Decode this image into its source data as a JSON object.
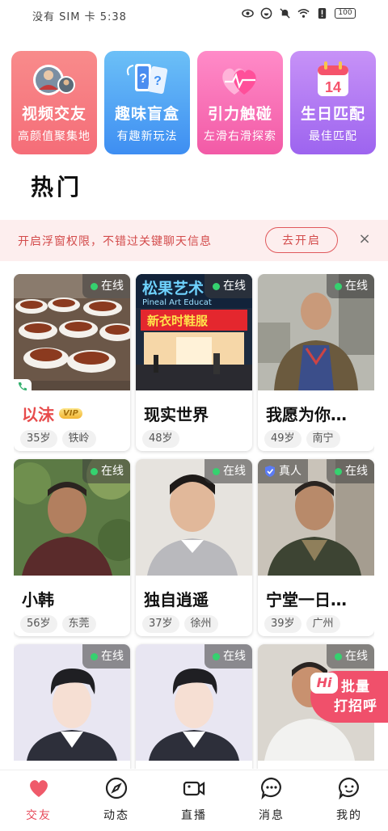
{
  "status_bar": {
    "carrier": "没有 SIM 卡 5:38",
    "battery": "100"
  },
  "features": [
    {
      "title": "视频交友",
      "subtitle": "高颜值聚集地",
      "icon": "video-avatars-icon"
    },
    {
      "title": "趣味盲盒",
      "subtitle": "有趣新玩法",
      "icon": "mystery-box-icon"
    },
    {
      "title": "引力触碰",
      "subtitle": "左滑右滑探索",
      "icon": "heart-pulse-icon"
    },
    {
      "title": "生日匹配",
      "subtitle": "最佳匹配",
      "icon": "calendar-14-icon"
    }
  ],
  "calendar_day": "14",
  "section_title": "热门",
  "notice": {
    "text": "开启浮窗权限，不错过关键聊天信息",
    "button": "去开启",
    "close": "×"
  },
  "online_label": "在线",
  "verified_label": "真人",
  "vip_label": "VIP",
  "profiles": [
    {
      "name": "以沫",
      "age": "35岁",
      "city": "铁岭",
      "vip": true,
      "verified": false
    },
    {
      "name": "现实世界",
      "age": "48岁",
      "city": "",
      "vip": false,
      "verified": false
    },
    {
      "name": "我愿为你…",
      "age": "49岁",
      "city": "南宁",
      "vip": false,
      "verified": false
    },
    {
      "name": "小韩",
      "age": "56岁",
      "city": "东莞",
      "vip": false,
      "verified": false
    },
    {
      "name": "独自逍遥",
      "age": "37岁",
      "city": "徐州",
      "vip": false,
      "verified": false
    },
    {
      "name": "宁堂一日…",
      "age": "39岁",
      "city": "广州",
      "vip": false,
      "verified": true
    },
    {
      "name": "",
      "age": "",
      "city": "",
      "vip": false,
      "verified": false
    },
    {
      "name": "",
      "age": "",
      "city": "",
      "vip": false,
      "verified": false
    },
    {
      "name": "",
      "age": "",
      "city": "",
      "vip": false,
      "verified": false
    }
  ],
  "photo_sign_text": "松果艺术",
  "photo_sign_sub": "Pineal Art Educat",
  "photo_shop_text": "新衣时鞋服",
  "batch_greet": {
    "hi": "Hi",
    "line1": "批量",
    "line2": "打招呼"
  },
  "nav": [
    {
      "label": "交友",
      "icon": "heart-icon",
      "active": true
    },
    {
      "label": "动态",
      "icon": "compass-icon",
      "active": false
    },
    {
      "label": "直播",
      "icon": "video-camera-icon",
      "active": false
    },
    {
      "label": "消息",
      "icon": "chat-bubble-icon",
      "active": false
    },
    {
      "label": "我的",
      "icon": "profile-face-icon",
      "active": false
    }
  ],
  "colors": {
    "accent": "#e74b5b",
    "notice_bg": "#fdeeee",
    "online_dot": "#35d16f"
  }
}
